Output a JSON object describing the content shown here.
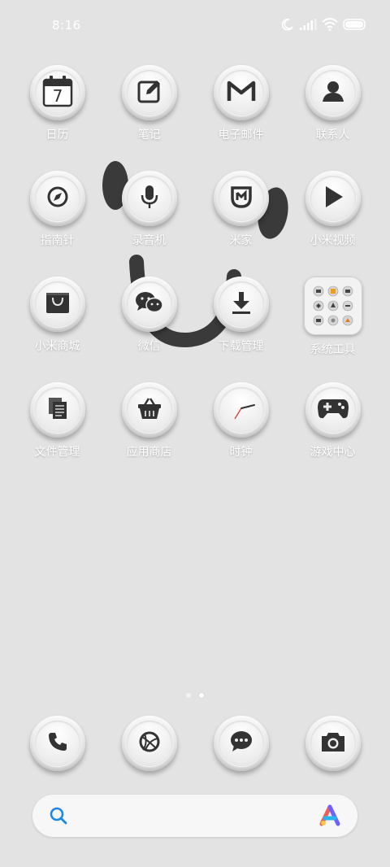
{
  "status_bar": {
    "time": "8:16",
    "icons": [
      "moon-icon",
      "signal-icon",
      "wifi-icon",
      "battery-icon"
    ]
  },
  "apps": [
    {
      "label": "日历",
      "icon": "calendar-icon",
      "calendar_day": "7"
    },
    {
      "label": "笔记",
      "icon": "notes-icon"
    },
    {
      "label": "电子邮件",
      "icon": "email-icon"
    },
    {
      "label": "联系人",
      "icon": "contacts-icon"
    },
    {
      "label": "指南针",
      "icon": "compass-icon"
    },
    {
      "label": "录音机",
      "icon": "microphone-icon"
    },
    {
      "label": "米家",
      "icon": "mijia-icon"
    },
    {
      "label": "小米视频",
      "icon": "video-play-icon"
    },
    {
      "label": "小米商城",
      "icon": "shopping-bag-icon"
    },
    {
      "label": "微信",
      "icon": "wechat-icon"
    },
    {
      "label": "下载管理",
      "icon": "download-icon"
    },
    {
      "label": "系统工具",
      "icon": "folder-icon"
    },
    {
      "label": "文件管理",
      "icon": "files-icon"
    },
    {
      "label": "应用商店",
      "icon": "basket-icon"
    },
    {
      "label": "时钟",
      "icon": "clock-icon"
    },
    {
      "label": "游戏中心",
      "icon": "gamepad-icon"
    }
  ],
  "dock": [
    {
      "icon": "phone-icon"
    },
    {
      "icon": "browser-icon"
    },
    {
      "icon": "messages-icon"
    },
    {
      "icon": "camera-icon"
    }
  ],
  "page_indicator": {
    "count": 2,
    "active": 2
  },
  "search_bar": {
    "icons": [
      "search-icon",
      "assistant-icon"
    ]
  },
  "colors": {
    "background": "#e3e3e3",
    "label": "#ffffff",
    "icon_glyph": "#333333",
    "search_accent": "#1e88e5"
  }
}
